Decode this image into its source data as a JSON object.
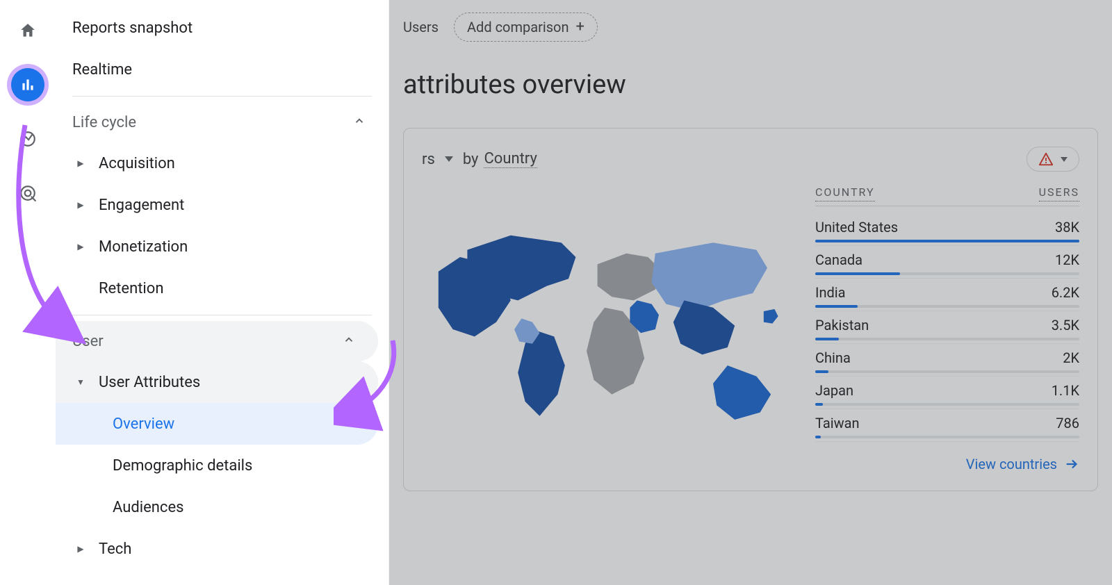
{
  "colors": {
    "accent": "#1a73e8",
    "highlight_ring": "#a870ff",
    "warn": "#d93025"
  },
  "sidebar": {
    "top": {
      "reports_snapshot": "Reports snapshot",
      "realtime": "Realtime"
    },
    "life_cycle": {
      "header": "Life cycle",
      "items": {
        "acquisition": "Acquisition",
        "engagement": "Engagement",
        "monetization": "Monetization",
        "retention": "Retention"
      }
    },
    "user": {
      "header": "User",
      "user_attributes": "User Attributes",
      "overview": "Overview",
      "demographic_details": "Demographic details",
      "audiences": "Audiences",
      "tech": "Tech"
    }
  },
  "topbar": {
    "users_partial": "Users",
    "add_comparison": "Add comparison"
  },
  "page": {
    "title_partial": " attributes overview"
  },
  "card": {
    "metric_partial": "rs",
    "by_word": "by",
    "dimension": "Country",
    "table": {
      "head_country": "COUNTRY",
      "head_users": "USERS"
    },
    "view_link": "View countries"
  },
  "chart_data": {
    "type": "bar",
    "title": "Users by Country",
    "xlabel": "Country",
    "ylabel": "Users",
    "categories": [
      "United States",
      "Canada",
      "India",
      "Pakistan",
      "China",
      "Japan",
      "Taiwan"
    ],
    "values": [
      38000,
      12000,
      6200,
      3500,
      2000,
      1100,
      786
    ],
    "display_values": [
      "38K",
      "12K",
      "6.2K",
      "3.5K",
      "2K",
      "1.1K",
      "786"
    ],
    "max_value": 38000
  }
}
